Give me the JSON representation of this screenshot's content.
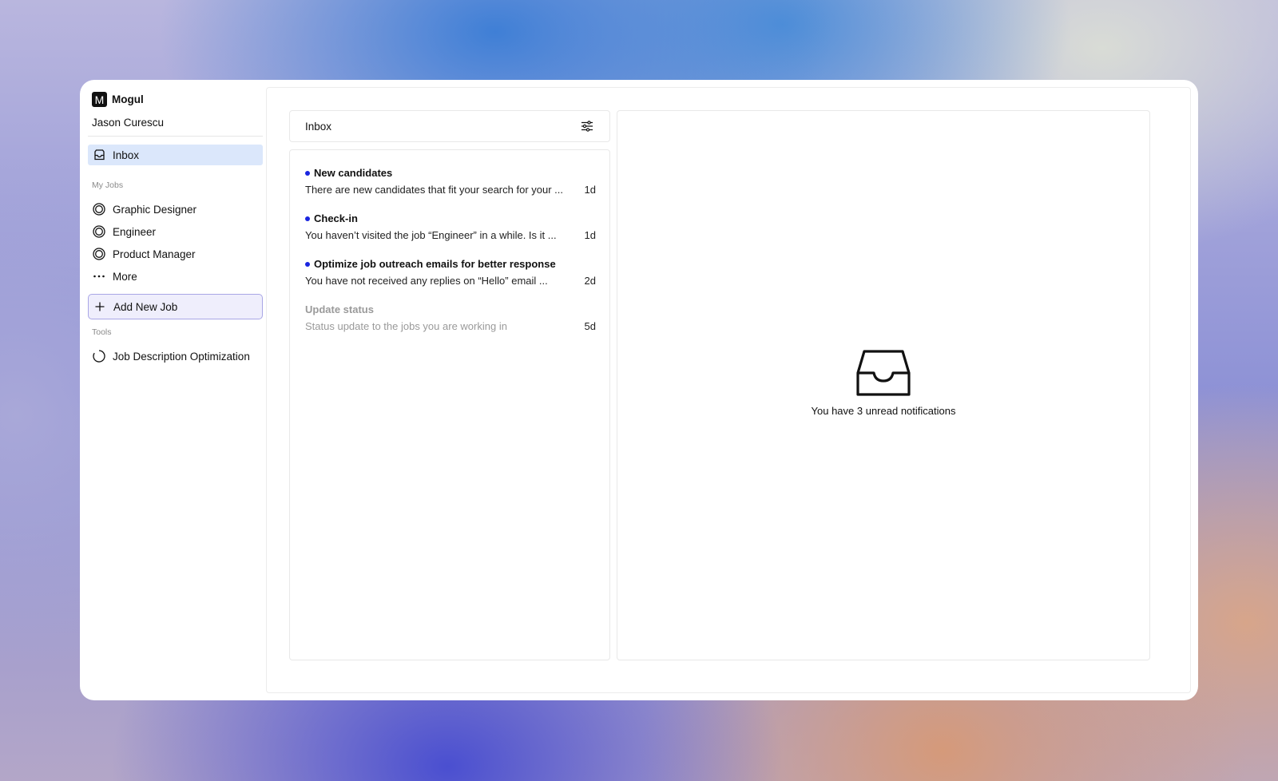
{
  "sidebar": {
    "brand": {
      "logo_letter": "M",
      "name": "Mogul"
    },
    "user_name": "Jason Curescu",
    "inbox_label": "Inbox",
    "my_jobs_label": "My Jobs",
    "jobs": [
      {
        "label": "Graphic Designer",
        "icon": "target-icon"
      },
      {
        "label": "Engineer",
        "icon": "target-icon"
      },
      {
        "label": "Product Manager",
        "icon": "target-icon"
      }
    ],
    "more_label": "More",
    "add_job_label": "Add New Job",
    "tools_label": "Tools",
    "tools": [
      {
        "label": "Job Description Optimization",
        "icon": "loading-circle-icon"
      }
    ]
  },
  "inbox": {
    "title": "Inbox",
    "filter_icon": "sliders-icon",
    "notifications": [
      {
        "title": "New candidates",
        "body": "There are new candidates that fit your search for your ...",
        "time": "1d",
        "unread": true
      },
      {
        "title": "Check-in",
        "body": "You haven’t visited the job “Engineer” in a while. Is it ...",
        "time": "1d",
        "unread": true
      },
      {
        "title": "Optimize job outreach emails for better response",
        "body": "You have not received any replies on “Hello” email ...",
        "time": "2d",
        "unread": true
      },
      {
        "title": "Update status",
        "body": "Status update to the jobs you are working in",
        "time": "5d",
        "unread": false
      }
    ]
  },
  "detail": {
    "empty_icon": "inbox-tray-icon",
    "empty_text": "You have 3 unread notifications"
  },
  "colors": {
    "accent_active": "#dbe7fb",
    "add_job_border": "#a9a6e6",
    "add_job_bg": "#efeefc",
    "unread_dot": "#1a25e0"
  }
}
